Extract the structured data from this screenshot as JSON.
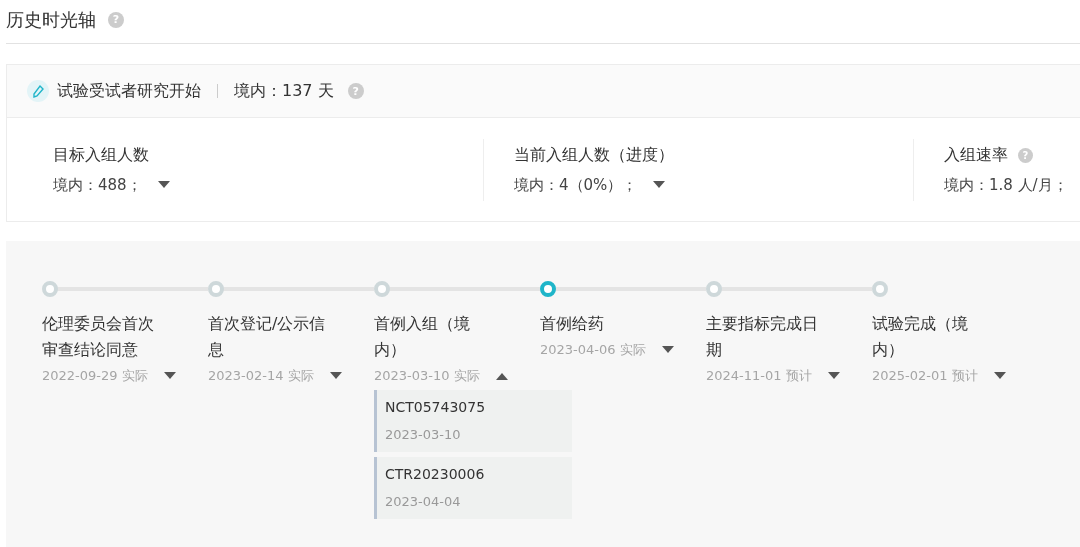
{
  "title": "历史时光轴",
  "title_help": "?",
  "summary": {
    "label": "试验受试者研究开始",
    "value": "境内：137 天",
    "help": "?"
  },
  "stats": [
    {
      "label": "目标入组人数",
      "value": "境内：488；",
      "dropdown": true
    },
    {
      "label": "当前入组人数（进度）",
      "value": "境内：4（0%）；",
      "dropdown": true
    },
    {
      "label": "入组速率",
      "value": "境内：1.8 人/月；",
      "help": "?",
      "dropdown": false
    }
  ],
  "steps": [
    {
      "label": "伦理委员会首次审查结论同意",
      "date": "2022-09-29 实际",
      "selected": false,
      "expanded": false
    },
    {
      "label": "首次登记/公示信息",
      "date": "2023-02-14 实际",
      "selected": false,
      "expanded": false
    },
    {
      "label": "首例入组（境内）",
      "date": "2023-03-10 实际",
      "selected": false,
      "expanded": true,
      "details": [
        {
          "id": "NCT05743075",
          "date": "2023-03-10"
        },
        {
          "id": "CTR20230006",
          "date": "2023-04-04"
        }
      ]
    },
    {
      "label": "首例给药",
      "date": "2023-04-06 实际",
      "selected": true,
      "expanded": false
    },
    {
      "label": "主要指标完成日期",
      "date": "2024-11-01 预计",
      "selected": false,
      "expanded": false
    },
    {
      "label": "试验完成（境内）",
      "date": "2025-02-01 预计",
      "selected": false,
      "expanded": false
    }
  ]
}
